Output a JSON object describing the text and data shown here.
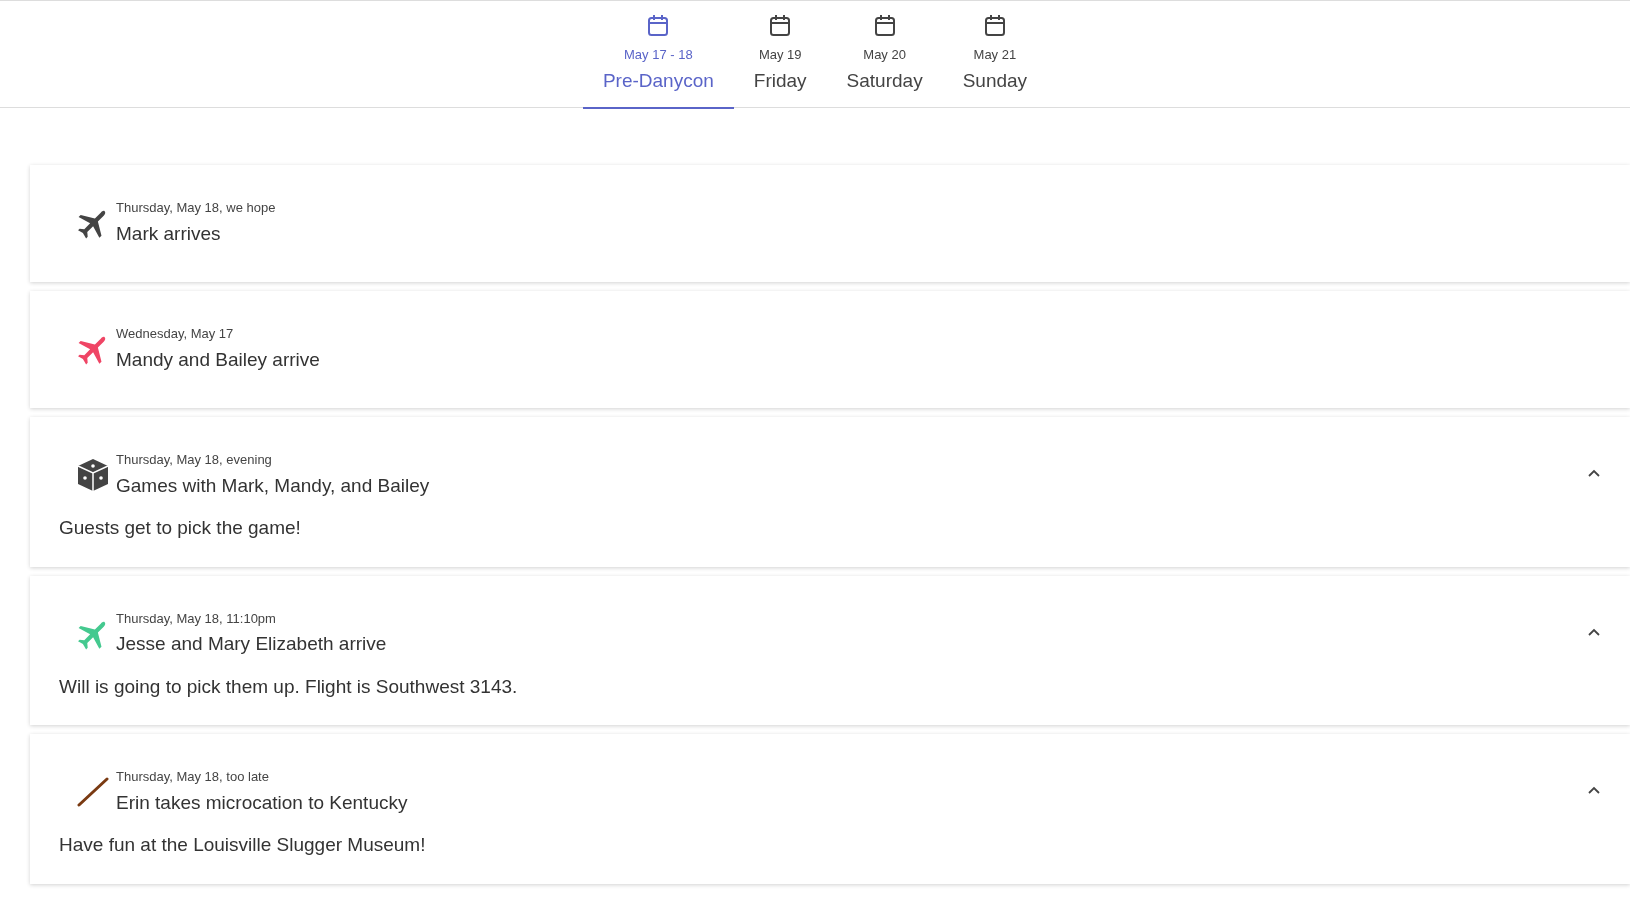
{
  "tabs": [
    {
      "date": "May 17 - 18",
      "label": "Pre-Danycon",
      "selected": true
    },
    {
      "date": "May 19",
      "label": "Friday",
      "selected": false
    },
    {
      "date": "May 20",
      "label": "Saturday",
      "selected": false
    },
    {
      "date": "May 21",
      "label": "Sunday",
      "selected": false
    }
  ],
  "events": [
    {
      "icon": {
        "kind": "plane",
        "color": "#444444"
      },
      "when": "Thursday, May 18, we hope",
      "title": "Mark arrives",
      "expanded": false
    },
    {
      "icon": {
        "kind": "plane",
        "color": "#ef4565"
      },
      "when": "Wednesday, May 17",
      "title": "Mandy and Bailey arrive",
      "expanded": false
    },
    {
      "icon": {
        "kind": "dice",
        "color": "#444444"
      },
      "when": "Thursday, May 18, evening",
      "title": "Games with Mark, Mandy, and Bailey",
      "expanded": true,
      "details": "Guests get to pick the game!"
    },
    {
      "icon": {
        "kind": "plane",
        "color": "#44c98f"
      },
      "when": "Thursday, May 18, 11:10pm",
      "title": "Jesse and Mary Elizabeth arrive",
      "expanded": true,
      "details": "Will is going to pick them up. Flight is Southwest 3143."
    },
    {
      "icon": {
        "kind": "bat",
        "color": "#7a3a12"
      },
      "when": "Thursday, May 18, too late",
      "title": "Erin takes microcation to Kentucky",
      "expanded": true,
      "details": "Have fun at the Louisville Slugger Museum!"
    }
  ]
}
